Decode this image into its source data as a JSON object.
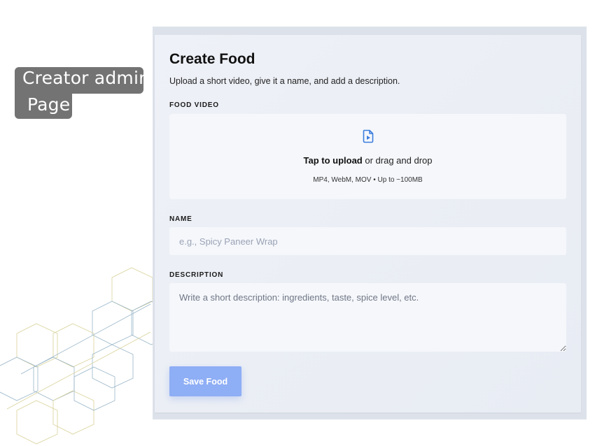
{
  "annotation": {
    "line1": "Creator admin",
    "line2": "Page"
  },
  "form": {
    "title": "Create Food",
    "subtitle": "Upload a short video, give it a name, and add a description.",
    "video": {
      "label": "FOOD VIDEO",
      "icon": "video-file-icon",
      "upload_strong": "Tap to upload",
      "upload_rest": " or drag and drop",
      "hint": "MP4, WebM, MOV • Up to ~100MB"
    },
    "name": {
      "label": "NAME",
      "placeholder": "e.g., Spicy Paneer Wrap",
      "value": ""
    },
    "description": {
      "label": "DESCRIPTION",
      "placeholder": "Write a short description: ingredients, taste, spice level, etc.",
      "value": ""
    },
    "save_label": "Save Food"
  },
  "colors": {
    "accent": "#8eaef5",
    "icon": "#3b7ddd",
    "annotation_bg": "#737373",
    "decoration": "#c9c27a"
  }
}
